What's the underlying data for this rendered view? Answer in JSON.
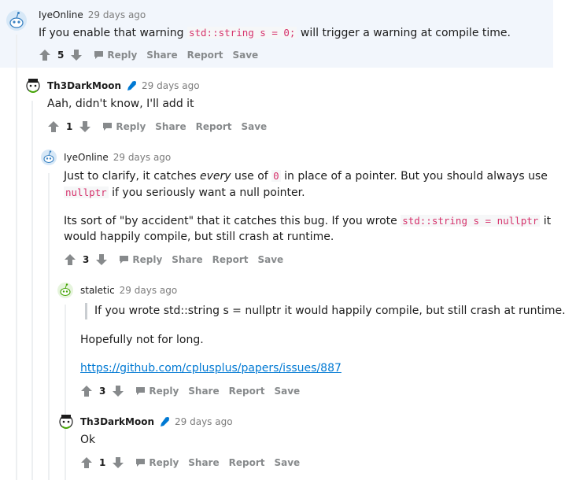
{
  "comments": [
    {
      "author": "IyeOnline",
      "time": "29 days ago",
      "body_before": "If you enable that warning ",
      "body_code": "std::string s = 0;",
      "body_after": " will trigger a warning at compile time.",
      "score": "5"
    },
    {
      "author": "Th3DarkMoon",
      "time": "29 days ago",
      "body": "Aah, didn't know, I'll add it",
      "score": "1"
    },
    {
      "author": "IyeOnline",
      "time": "29 days ago",
      "p1_a": "Just to clarify, it catches ",
      "p1_em": "every",
      "p1_b": " use of ",
      "p1_code": "0",
      "p1_c": " in place of a pointer. But you should always use",
      "p1_code2": "nullptr",
      "p1_d": " if you seriously want a null pointer.",
      "p2_a": "Its sort of \"by accident\" that it catches this bug. If you wrote ",
      "p2_code": "std::string s = nullptr",
      "p2_b": " it",
      "p2_c": "would happily compile, but still crash at runtime.",
      "score": "3"
    },
    {
      "author": "staletic",
      "time": "29 days ago",
      "quote": "If you wrote std::string s = nullptr it would happily compile, but still crash at runtime.",
      "body": "Hopefully not for long.",
      "link": "https://github.com/cplusplus/papers/issues/887",
      "score": "3"
    },
    {
      "author": "Th3DarkMoon",
      "time": "29 days ago",
      "body": "Ok",
      "score": "1"
    }
  ],
  "actions": {
    "reply": "Reply",
    "share": "Share",
    "report": "Report",
    "save": "Save"
  },
  "icons": {
    "upvote": "arrow-up-icon",
    "downvote": "arrow-down-icon",
    "reply": "comment-bubble-icon",
    "mod": "microphone-icon"
  },
  "colors": {
    "highlight_bg": "#f2f6fc",
    "thread_line": "#edeff1",
    "link": "#0079d3",
    "code": "#d6336c",
    "mod_icon": "#0079d3"
  }
}
